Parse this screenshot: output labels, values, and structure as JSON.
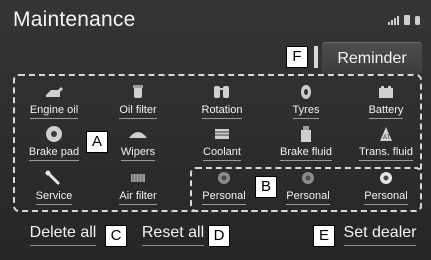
{
  "title": "Maintenance",
  "reminder_label": "Reminder",
  "callouts": {
    "a": "A",
    "b": "B",
    "c": "C",
    "d": "D",
    "e": "E",
    "f": "F"
  },
  "items": [
    {
      "label": "Engine oil",
      "icon": "engine-oil-icon"
    },
    {
      "label": "Oil filter",
      "icon": "oil-filter-icon"
    },
    {
      "label": "Rotation",
      "icon": "tyre-rotation-icon"
    },
    {
      "label": "Tyres",
      "icon": "tyre-icon"
    },
    {
      "label": "Battery",
      "icon": "battery-icon"
    },
    {
      "label": "Brake pad",
      "icon": "brake-pad-icon"
    },
    {
      "label": "Wipers",
      "icon": "wiper-icon"
    },
    {
      "label": "Coolant",
      "icon": "coolant-icon"
    },
    {
      "label": "Brake fluid",
      "icon": "brake-fluid-icon"
    },
    {
      "label": "Trans. fluid",
      "icon": "trans-fluid-icon"
    },
    {
      "label": "Service",
      "icon": "wrench-icon"
    },
    {
      "label": "Air filter",
      "icon": "air-filter-icon"
    },
    {
      "label": "Personal",
      "icon": "personal-icon"
    },
    {
      "label": "Personal",
      "icon": "personal-icon"
    },
    {
      "label": "Personal",
      "icon": "personal-icon"
    }
  ],
  "bottom": {
    "delete_all": "Delete all",
    "reset_all": "Reset all",
    "set_dealer": "Set dealer"
  }
}
